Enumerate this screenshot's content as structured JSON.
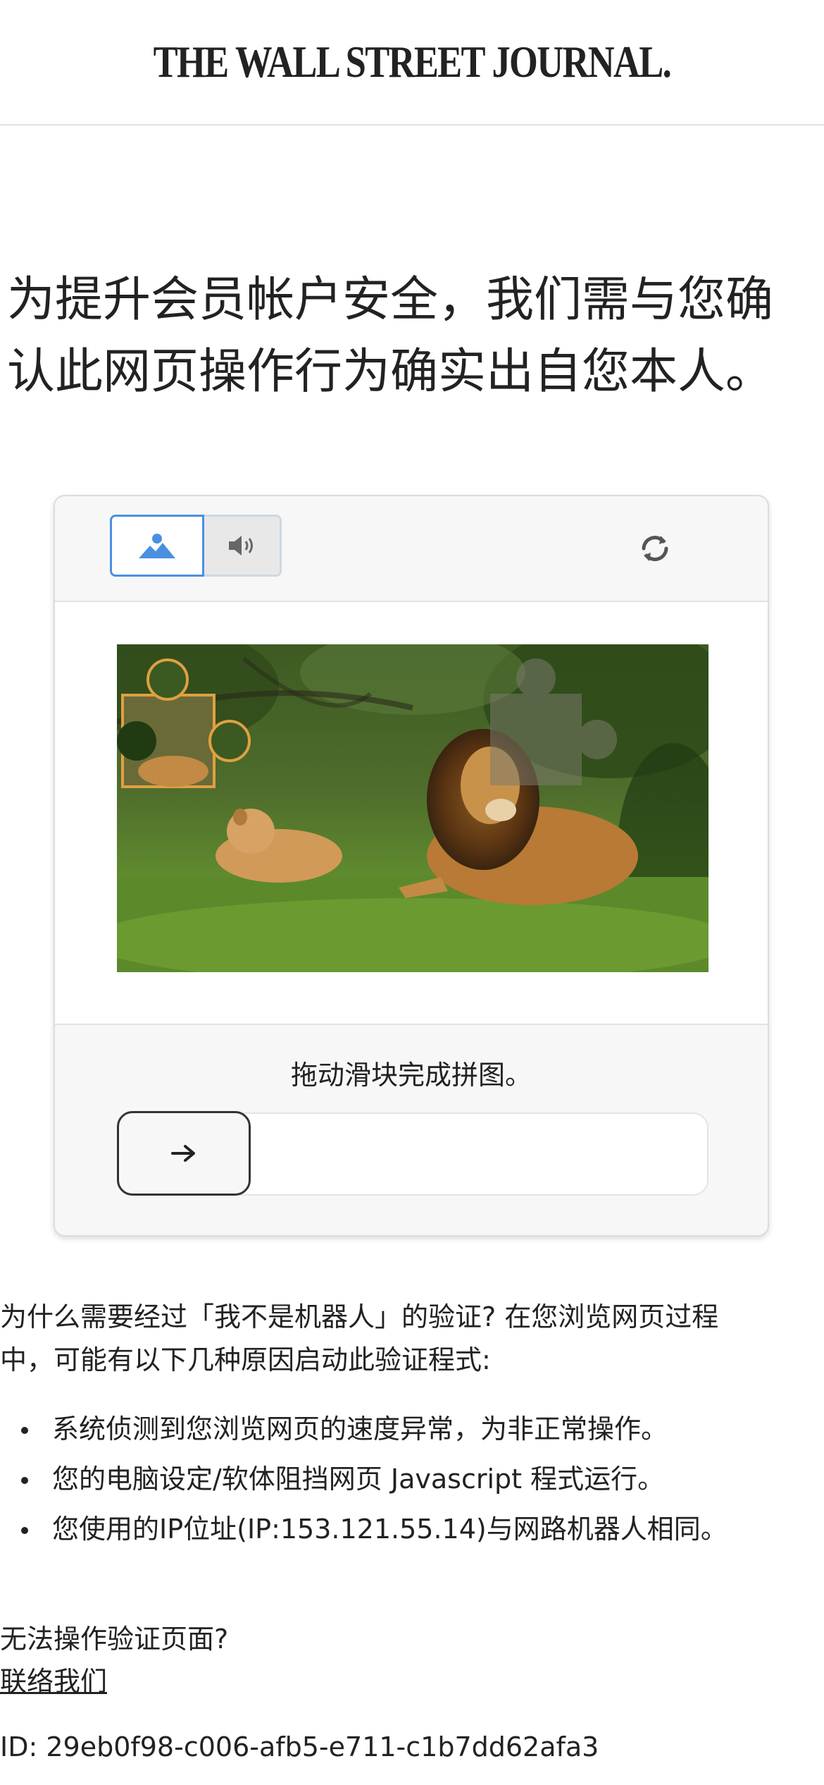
{
  "header": {
    "brand": "THE WALL STREET JOURNAL."
  },
  "headline": {
    "line1": "为提升会员帐户安全，我们需与您确",
    "line2": "认此网页操作行为确实出自您本人。"
  },
  "captcha": {
    "modes": [
      {
        "name": "image",
        "icon": "image-mountain-icon",
        "selected": true
      },
      {
        "name": "audio",
        "icon": "speaker-icon",
        "selected": false
      }
    ],
    "refresh_icon": "refresh-icon",
    "image_description_icon": "lion-photo-puzzle",
    "instruction": "拖动滑块完成拼图。",
    "slider_icon": "arrow-right-icon",
    "accent_color": "#4a90e2",
    "piece_outline_color": "#e0a040"
  },
  "explanation": {
    "line1": "为什么需要经过「我不是机器人」的验证? 在您浏览网页过程",
    "line2": "中，可能有以下几种原因启动此验证程式:",
    "reasons": [
      "系统侦测到您浏览网页的速度异常，为非正常操作。",
      "您的电脑设定/软体阻挡网页 Javascript 程式运行。",
      "您使用的IP位址(IP:153.121.55.14)与网路机器人相同。"
    ]
  },
  "help": {
    "question": "无法操作验证页面?",
    "contact_link": "联络我们"
  },
  "reference": {
    "id_text": "ID: 29eb0f98-c006-afb5-e711-c1b7dd62afa3"
  }
}
